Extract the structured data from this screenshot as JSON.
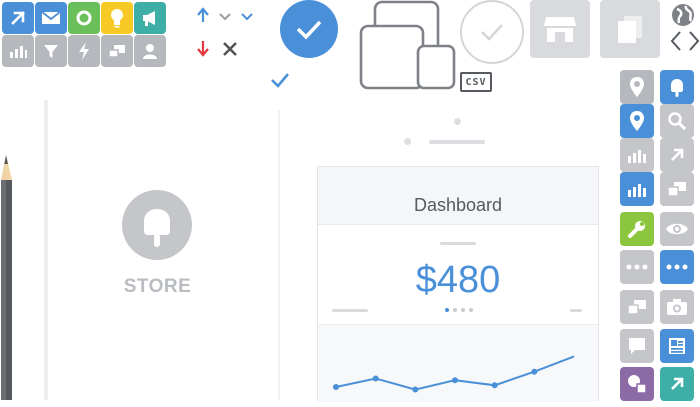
{
  "colors": {
    "blue": "#4a90d9",
    "gray_tile": "#b5b8bd",
    "green": "#6bbf5a",
    "yellow": "#f6c924",
    "teal": "#3dafa7",
    "lime": "#8cc63f",
    "purple": "#8b6aa6",
    "red": "#e0393e"
  },
  "toolbar": {
    "top_icons": [
      "arrow-up-right-icon",
      "mail-icon",
      "circle-icon",
      "bulb-icon",
      "megaphone-icon"
    ],
    "bottom_icons": [
      "bar-chart-icon",
      "funnel-icon",
      "lightning-icon",
      "layers-icon",
      "person-icon"
    ]
  },
  "badges": {
    "csv": "CSV"
  },
  "store_panel": {
    "label": "STORE",
    "icon": "popsicle-icon"
  },
  "dashboard": {
    "title": "Dashboard",
    "amount": "$480",
    "pager": {
      "pages": 4,
      "active": 1
    },
    "chart_data": {
      "type": "line",
      "values": [
        20,
        30,
        17,
        28,
        22,
        38,
        56
      ],
      "title": "",
      "xlabel": "",
      "ylabel": ""
    }
  },
  "side_icons": {
    "left": [
      "map-pin-icon",
      "map-pin-icon",
      "bar-chart-icon",
      "bar-chart-icon",
      "wrench-icon",
      "more-icon",
      "layers-icon",
      "comment-icon",
      "shapes-icon"
    ],
    "right": [
      "popsicle-icon",
      "search-icon",
      "arrow-up-right-icon",
      "layers-icon",
      "eye-icon",
      "more-icon",
      "camera-icon",
      "news-icon",
      "arrow-up-right-icon"
    ]
  }
}
